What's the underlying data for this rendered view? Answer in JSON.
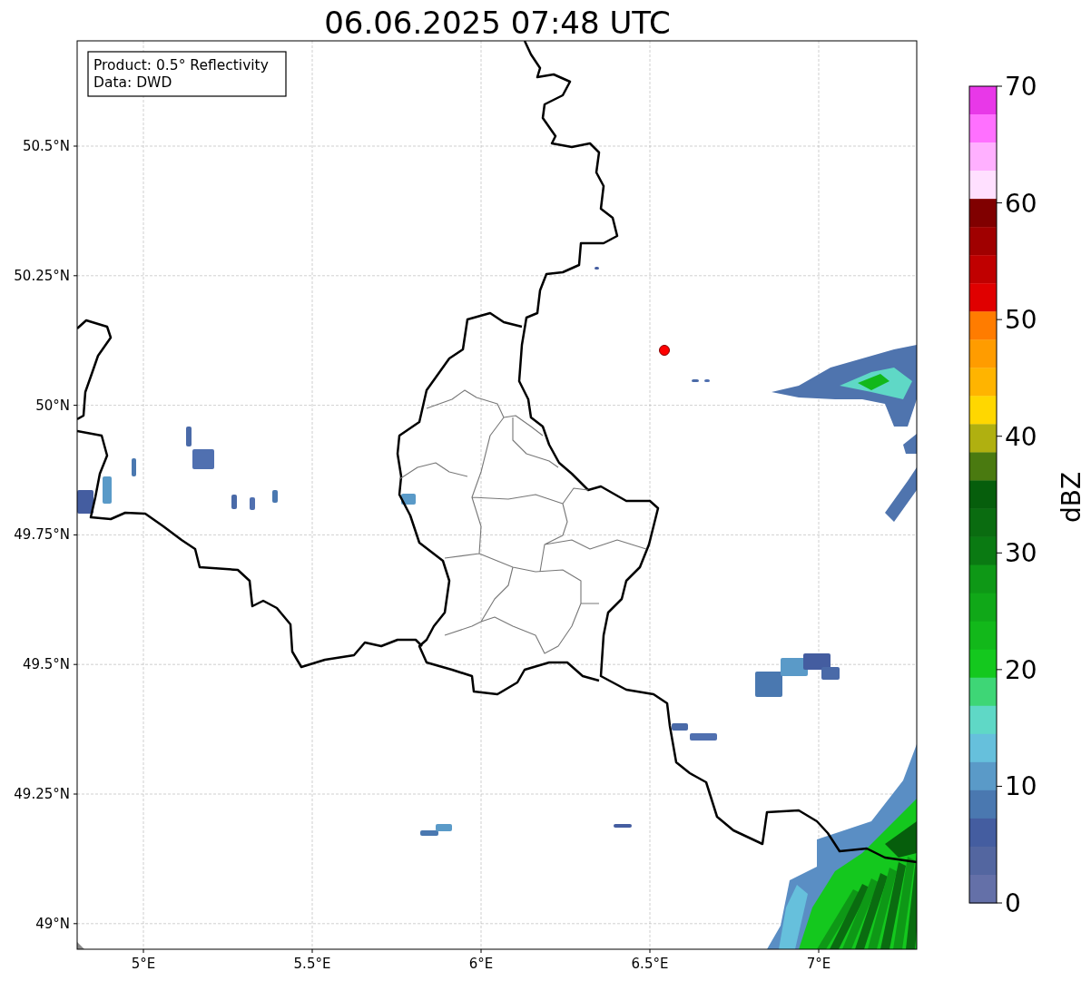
{
  "title": "06.06.2025 07:48 UTC",
  "info_box": [
    "Product: 0.5° Reflectivity",
    "Data: DWD"
  ],
  "map": {
    "lat_ticks": [
      "50.5°N",
      "50.25°N",
      "50°N",
      "49.75°N",
      "49.5°N",
      "49.25°N",
      "49°N"
    ],
    "lon_ticks": [
      "5°E",
      "5.5°E",
      "6°E",
      "6.5°E",
      "7°E"
    ]
  },
  "colorbar": {
    "label": "dBZ",
    "ticks": [
      "70",
      "60",
      "50",
      "40",
      "30",
      "20",
      "10",
      "0"
    ],
    "segments": [
      {
        "color": "#e838e8"
      },
      {
        "color": "#ff70ff"
      },
      {
        "color": "#ffb0ff"
      },
      {
        "color": "#ffe0ff"
      },
      {
        "color": "#800000"
      },
      {
        "color": "#a00000"
      },
      {
        "color": "#c00000"
      },
      {
        "color": "#e00000"
      },
      {
        "color": "#ff7c00"
      },
      {
        "color": "#ff9c00"
      },
      {
        "color": "#ffb400"
      },
      {
        "color": "#ffd700"
      },
      {
        "color": "#b0b010"
      },
      {
        "color": "#4a7a10"
      },
      {
        "color": "#065e0c"
      },
      {
        "color": "#0a6c10"
      },
      {
        "color": "#0a7a12"
      },
      {
        "color": "#0e9816"
      },
      {
        "color": "#10a818"
      },
      {
        "color": "#12b81a"
      },
      {
        "color": "#14c81e"
      },
      {
        "color": "#3ed676"
      },
      {
        "color": "#5fd8c6"
      },
      {
        "color": "#66c0dc"
      },
      {
        "color": "#5a9ac8"
      },
      {
        "color": "#4a78b0"
      },
      {
        "color": "#445da0"
      },
      {
        "color": "#5366a0"
      },
      {
        "color": "#6470a8"
      }
    ]
  }
}
